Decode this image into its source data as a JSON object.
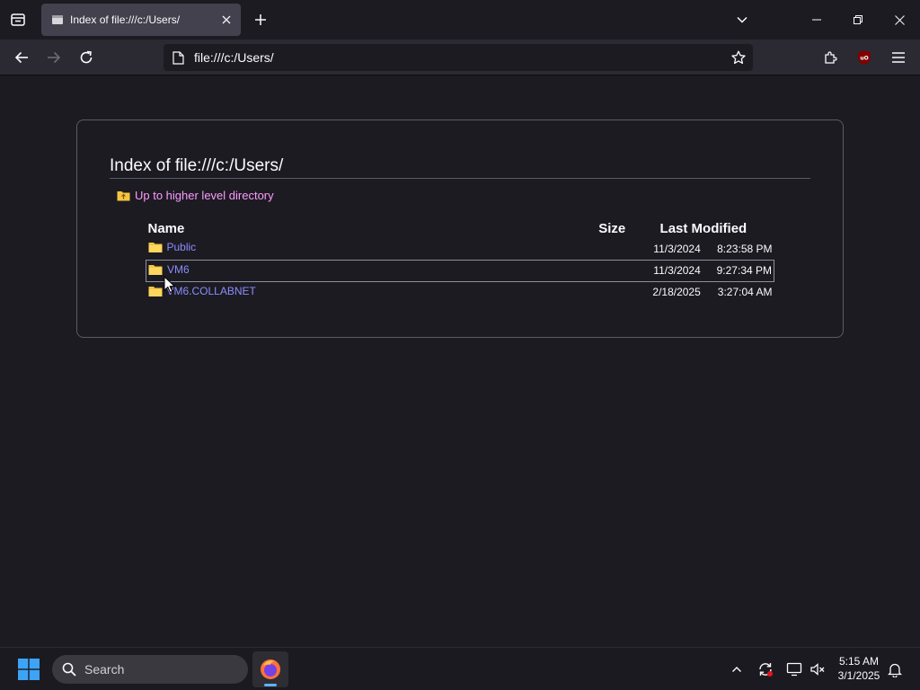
{
  "browser": {
    "tab": {
      "title": "Index of file:///c:/Users/",
      "favicon": "page-icon"
    },
    "url": "file:///c:/Users/",
    "icons": {
      "tab_list": "tab-list-icon",
      "new_tab": "plus-icon",
      "tabs_dropdown": "chevron-down-icon",
      "back": "back-arrow-icon",
      "forward": "forward-arrow-icon",
      "reload": "reload-icon",
      "bookmark": "star-icon",
      "extensions": "puzzle-icon",
      "ublock": "ublock-origin-icon",
      "menu": "hamburger-menu-icon"
    }
  },
  "page": {
    "title": "Index of file:///c:/Users/",
    "up_link": "Up to higher level directory",
    "headers": {
      "name": "Name",
      "size": "Size",
      "modified": "Last Modified"
    },
    "rows": [
      {
        "name": "Public",
        "size": "",
        "date": "11/3/2024",
        "time": "8:23:58 PM"
      },
      {
        "name": "VM6",
        "size": "",
        "date": "11/3/2024",
        "time": "9:27:34 PM"
      },
      {
        "name": "VM6.COLLABNET",
        "size": "",
        "date": "2/18/2025",
        "time": "3:27:04 AM"
      }
    ]
  },
  "taskbar": {
    "search_placeholder": "Search",
    "clock_time": "5:15 AM",
    "clock_date": "3/1/2025"
  },
  "colors": {
    "background": "#1c1b22",
    "toolbar": "#2b2a33",
    "link": "#8c8cff",
    "visited_link": "#ff9aff",
    "folder": "#f5c542"
  }
}
